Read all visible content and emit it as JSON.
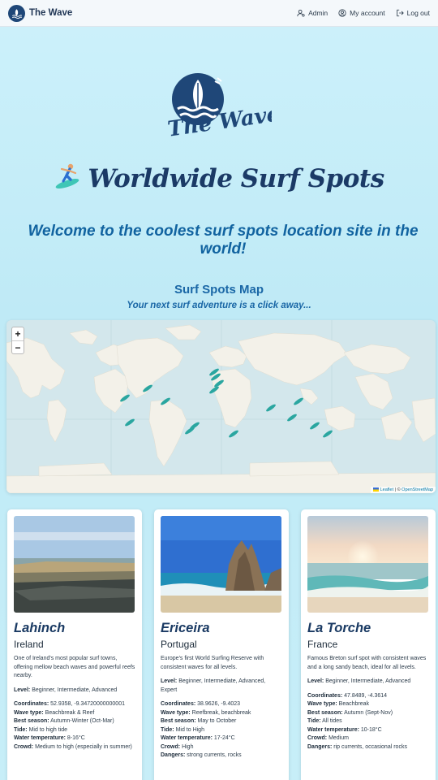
{
  "nav": {
    "brand": "The Wave",
    "admin": "Admin",
    "account": "My account",
    "logout": "Log out"
  },
  "hero": {
    "logo_text": "The Wave",
    "title": "Worldwide Surf Spots",
    "surfer_icon": "surfer-icon",
    "welcome": "Welcome to the coolest surf spots location site in the world!"
  },
  "map": {
    "title": "Surf Spots Map",
    "subtitle": "Your next surf adventure is a click away...",
    "zoom_in": "+",
    "zoom_out": "−",
    "attribution_leaflet": "Leaflet",
    "attribution_sep": " | © ",
    "attribution_osm": "OpenStreetMap",
    "marker_count": 16
  },
  "cards": [
    {
      "name": "Lahinch",
      "country": "Ireland",
      "description": "One of Ireland's most popular surf towns, offering mellow beach waves and powerful reefs nearby.",
      "level_label": "Level:",
      "level": "Beginner, Intermediate, Advanced",
      "coords_label": "Coordinates:",
      "coords": "52.9358, -9.34720000000001",
      "wave_label": "Wave type:",
      "wave": "Beachbreak & Reef",
      "season_label": "Best season:",
      "season": "Autumn-Winter (Oct-Mar)",
      "tide_label": "Tide:",
      "tide": "Mid to high tide",
      "water_label": "Water temperature:",
      "water": "8-16°C",
      "crowd_label": "Crowd:",
      "crowd": "Medium to high (especially in summer)"
    },
    {
      "name": "Ericeira",
      "country": "Portugal",
      "description": "Europe's first World Surfing Reserve with consistent waves for all levels.",
      "level_label": "Level:",
      "level": "Beginner, Intermediate, Advanced, Expert",
      "coords_label": "Coordinates:",
      "coords": "38.9626, -9.4023",
      "wave_label": "Wave type:",
      "wave": "Reefbreak, beachbreak",
      "season_label": "Best season:",
      "season": "May to October",
      "tide_label": "Tide:",
      "tide": "Mid to High",
      "water_label": "Water temperature:",
      "water": "17-24°C",
      "crowd_label": "Crowd:",
      "crowd": "High",
      "dangers_label": "Dangers:",
      "dangers": "strong currents, rocks"
    },
    {
      "name": "La Torche",
      "country": "France",
      "description": "Famous Breton surf spot with consistent waves and a long sandy beach, ideal for all levels.",
      "level_label": "Level:",
      "level": "Beginner, Intermediate, Advanced",
      "coords_label": "Coordinates:",
      "coords": "47.8489, -4.3614",
      "wave_label": "Wave type:",
      "wave": "Beachbreak",
      "season_label": "Best season:",
      "season": "Autumn (Sept-Nov)",
      "tide_label": "Tide:",
      "tide": "All tides",
      "water_label": "Water temperature:",
      "water": "10-18°C",
      "crowd_label": "Crowd:",
      "crowd": "Medium",
      "dangers_label": "Dangers:",
      "dangers": "rip currents, occasional rocks"
    }
  ],
  "colors": {
    "brand_navy": "#1f4778",
    "title_navy": "#1b3a66",
    "accent_blue": "#1163a0",
    "marker_teal": "#2aa6a0",
    "map_water": "#d3e7ec",
    "map_land": "#f3f1e9"
  }
}
